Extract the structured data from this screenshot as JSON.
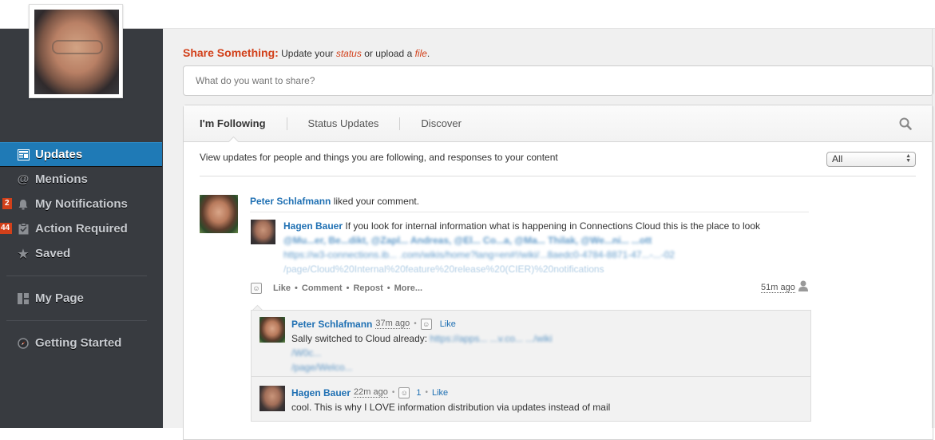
{
  "sidebar": {
    "items": [
      {
        "label": "Updates",
        "icon": "updates-icon",
        "active": true
      },
      {
        "label": "Mentions",
        "icon": "at-icon"
      },
      {
        "label": "My Notifications",
        "icon": "bell-icon",
        "badge": "2"
      },
      {
        "label": "Action Required",
        "icon": "clipboard-check-icon",
        "badge": "44"
      },
      {
        "label": "Saved",
        "icon": "star-icon"
      },
      {
        "label": "My Page",
        "icon": "page-layout-icon"
      },
      {
        "label": "Getting Started",
        "icon": "compass-icon"
      }
    ]
  },
  "share": {
    "title": "Share Something:",
    "prompt_before": " Update your ",
    "status_link": "status",
    "prompt_middle": " or upload a ",
    "file_link": "file",
    "prompt_after": ".",
    "placeholder": "What do you want to share?"
  },
  "tabs": [
    {
      "label": "I'm Following",
      "active": true
    },
    {
      "label": "Status Updates"
    },
    {
      "label": "Discover"
    }
  ],
  "feed": {
    "description": "View updates for people and things you are following, and responses to your content",
    "filter_value": "All",
    "story": {
      "actor": "Peter Schlafmann",
      "action": " liked your comment.",
      "post_author": "Hagen Bauer",
      "post_text": " If you look for internal information what is happening in Connections Cloud this is the place to look",
      "mentions_line": "@Mu...er, Be...dikt, @Zapl... Andreas, @El... Co...a, @Ma... Thilak, @We...ni... ...ott",
      "link_line1": "https://w3-connections.ib... .com/wikis/home?lang=en#!/wiki/...8aedc0-4784-8871-47...-...-02",
      "link_line2": "/page/Cloud%20Internal%20feature%20release%20(CIER)%20notifications",
      "actions": [
        "Like",
        "Comment",
        "Repost",
        "More..."
      ],
      "timestamp": "51m ago"
    },
    "comments": [
      {
        "author": "Peter Schlafmann",
        "timestamp": "37m ago",
        "like_label": "Like",
        "text": "Sally switched to Cloud already: ",
        "link1": "https://apps... ...v.co... .../wiki",
        "link2": "/W0c...",
        "link3": "/page/Welco..."
      },
      {
        "author": "Hagen Bauer",
        "timestamp": "22m ago",
        "like_count": "1",
        "like_label": "Like",
        "text": "cool. This is why I LOVE information distribution via updates instead of mail"
      }
    ]
  }
}
